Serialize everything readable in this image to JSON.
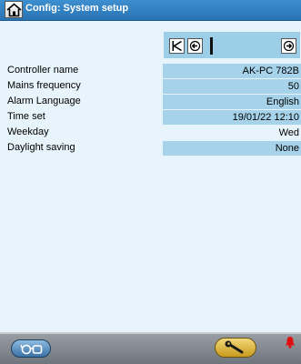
{
  "header": {
    "title": "Config: System setup",
    "home_icon": "home-icon"
  },
  "nav": {
    "icons": [
      "first-page-icon",
      "previous-icon",
      "text-cursor",
      "next-icon"
    ]
  },
  "settings": [
    {
      "label": "Controller name",
      "value": "AK-PC 782B"
    },
    {
      "label": "Mains frequency",
      "value": "50"
    },
    {
      "label": "Alarm Language",
      "value": "English"
    },
    {
      "label": "Time set",
      "value": "19/01/22 12:10"
    },
    {
      "label": "Weekday",
      "value": "Wed"
    },
    {
      "label": "Daylight saving",
      "value": "None"
    }
  ],
  "footer": {
    "left_icon": "glasses-icon",
    "right_icon": "wrench-icon",
    "alarm_icon": "alarm-bell-icon"
  },
  "colors": {
    "titlebar": "#2f7fc1",
    "background": "#e8f4fb",
    "value_field": "#a6d3ea",
    "alarm": "#e01010"
  }
}
